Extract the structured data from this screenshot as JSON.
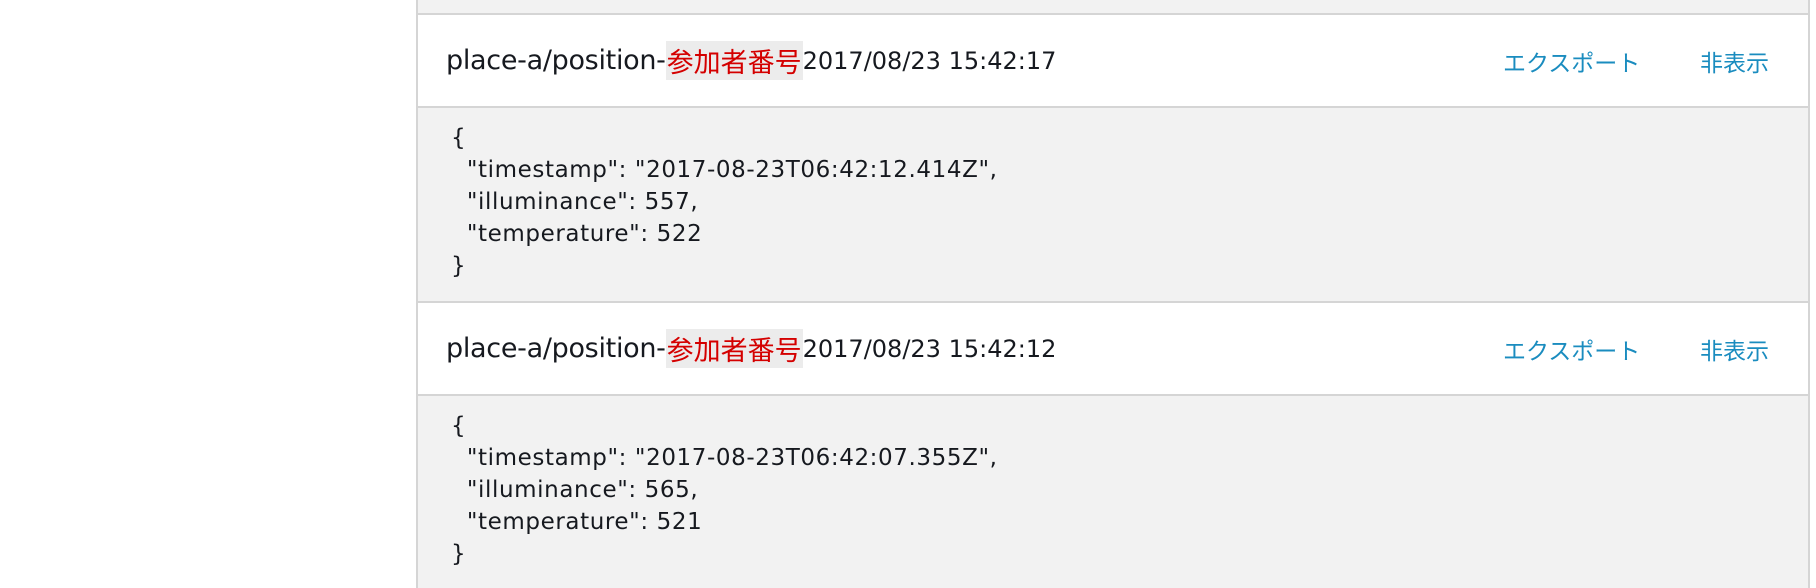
{
  "messages": [
    {
      "topic_prefix": "place-a/position-",
      "participant": "参加者番号",
      "time": "2017/08/23 15:42:17",
      "export_label": "エクスポート",
      "hide_label": "非表示",
      "payload": "{\n  \"timestamp\": \"2017-08-23T06:42:12.414Z\",\n  \"illuminance\": 557,\n  \"temperature\": 522\n}"
    },
    {
      "topic_prefix": "place-a/position-",
      "participant": "参加者番号",
      "time": "2017/08/23 15:42:12",
      "export_label": "エクスポート",
      "hide_label": "非表示",
      "payload": "{\n  \"timestamp\": \"2017-08-23T06:42:07.355Z\",\n  \"illuminance\": 565,\n  \"temperature\": 521\n}"
    }
  ],
  "colors": {
    "link": "#1a8cbf",
    "participant_text": "#d40000",
    "panel_border": "#d5d5d5",
    "body_bg": "#f2f2f2"
  }
}
